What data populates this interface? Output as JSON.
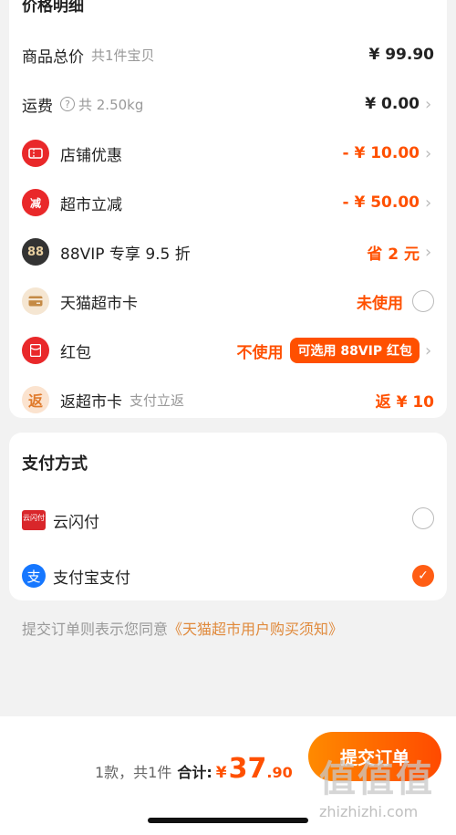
{
  "price_section": {
    "cut_title": "价格明细",
    "rows": [
      {
        "label": "商品总价",
        "sub": "共1件宝贝",
        "value": "¥ 99.90"
      },
      {
        "label": "运费",
        "sub": "共 2.50kg",
        "value": "¥ 0.00"
      },
      {
        "label": "店铺优惠",
        "value": "- ¥ 10.00"
      },
      {
        "label": "超市立减",
        "value": "- ¥ 50.00"
      },
      {
        "label": "88VIP 专享 9.5 折",
        "value": "省 2 元"
      },
      {
        "label": "天猫超市卡",
        "value": "未使用"
      },
      {
        "label": "红包",
        "value": "不使用",
        "pill": "可选用 88VIP 红包"
      },
      {
        "label": "返超市卡",
        "sub": "支付立返",
        "value": "返 ¥ 10"
      }
    ],
    "icons": {
      "shop": "🎫",
      "market": "减",
      "vip": "88",
      "card": "▬",
      "redpacket": "¥",
      "rebate": "返"
    }
  },
  "payment": {
    "title": "支付方式",
    "options": [
      {
        "label": "云闪付",
        "icon_text": "云闪付",
        "selected": false
      },
      {
        "label": "支付宝支付",
        "icon_text": "支",
        "selected": true
      }
    ]
  },
  "agreement": {
    "prefix": "提交订单则表示您同意",
    "link": "《天猫超市用户购买须知》"
  },
  "bottom": {
    "count": "1款，共1件",
    "total_label": "合计:",
    "yen": "¥",
    "amount_int": "37",
    "amount_dec": ".90",
    "submit": "提交订单"
  },
  "watermark": {
    "glyphs": "值值值",
    "text": "zhizhizhi.com"
  },
  "colors": {
    "accent": "#ff5000",
    "background": "#f2f2f2",
    "alipay": "#1677ff",
    "red_icon": "#e9282a"
  }
}
